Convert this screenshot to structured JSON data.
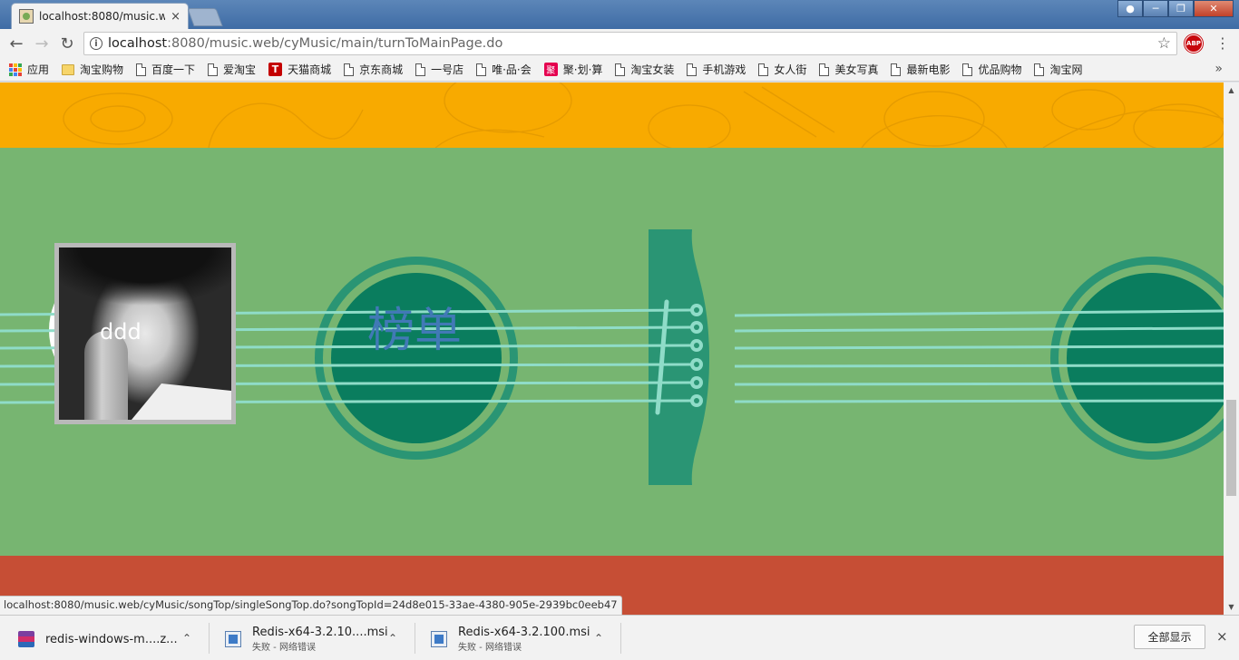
{
  "browser": {
    "tab_title": "localhost:8080/music.w",
    "tab_close": "×",
    "url_host": "localhost",
    "url_path": ":8080/music.web/cyMusic/main/turnToMainPage.do",
    "abp_label": "ABP",
    "bookmarks": [
      {
        "label": "应用",
        "icon": "apps-icon"
      },
      {
        "label": "淘宝购物",
        "icon": "folder-icon"
      },
      {
        "label": "百度一下",
        "icon": "page-icon"
      },
      {
        "label": "爱淘宝",
        "icon": "page-icon"
      },
      {
        "label": "天猫商城",
        "icon": "tmall-icon"
      },
      {
        "label": "京东商城",
        "icon": "page-icon"
      },
      {
        "label": "一号店",
        "icon": "page-icon"
      },
      {
        "label": "唯·品·会",
        "icon": "page-icon"
      },
      {
        "label": "聚·划·算",
        "icon": "ju-icon"
      },
      {
        "label": "淘宝女装",
        "icon": "page-icon"
      },
      {
        "label": "手机游戏",
        "icon": "page-icon"
      },
      {
        "label": "女人街",
        "icon": "page-icon"
      },
      {
        "label": "美女写真",
        "icon": "page-icon"
      },
      {
        "label": "最新电影",
        "icon": "page-icon"
      },
      {
        "label": "优品购物",
        "icon": "page-icon"
      },
      {
        "label": "淘宝网",
        "icon": "page-icon"
      }
    ],
    "bookmarks_more": "»"
  },
  "page": {
    "album_label": "ddd",
    "rank_label": "榜单",
    "colors": {
      "orange": "#f8aa00",
      "green": "#77b571",
      "red": "#c64e35",
      "dark_green": "#0a7d5e",
      "rim": "#2a9574",
      "strings": "#8fdcc8",
      "label_blue": "#4179b6"
    }
  },
  "status_url": "localhost:8080/music.web/cyMusic/songTop/singleSongTop.do?songTopId=24d8e015-33ae-4380-905e-2939bc0eeb47",
  "downloads": {
    "items": [
      {
        "name": "redis-windows-m....z...",
        "status": "",
        "icon": "rar"
      },
      {
        "name": "Redis-x64-3.2.10....msi",
        "status": "失败 - 网络错误",
        "icon": "msi"
      },
      {
        "name": "Redis-x64-3.2.100.msi",
        "status": "失败 - 网络错误",
        "icon": "msi"
      }
    ],
    "show_all": "全部显示",
    "close": "×"
  }
}
